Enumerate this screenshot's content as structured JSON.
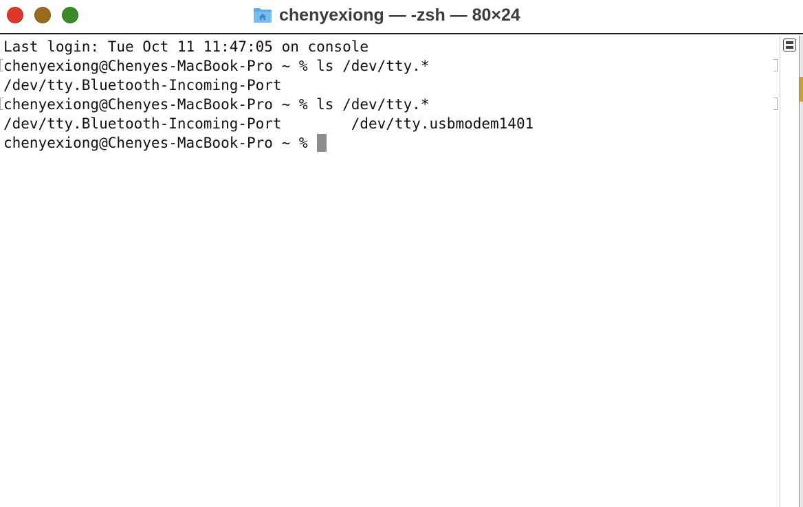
{
  "window": {
    "title": "chenyexiong — -zsh — 80×24"
  },
  "traffic_lights": {
    "close_color": "#e0372a",
    "minimize_color": "#9a6b1e",
    "zoom_color": "#3b8a2a"
  },
  "terminal": {
    "lines": [
      "Last login: Tue Oct 11 11:47:05 on console",
      "chenyexiong@Chenyes-MacBook-Pro ~ % ls /dev/tty.*",
      "/dev/tty.Bluetooth-Incoming-Port",
      "chenyexiong@Chenyes-MacBook-Pro ~ % ls /dev/tty.*",
      "/dev/tty.Bluetooth-Incoming-Port        /dev/tty.usbmodem1401",
      "chenyexiong@Chenyes-MacBook-Pro ~ % "
    ]
  },
  "icons": {
    "title_icon": "home-folder-icon",
    "split_pane": "split-pane-icon"
  }
}
